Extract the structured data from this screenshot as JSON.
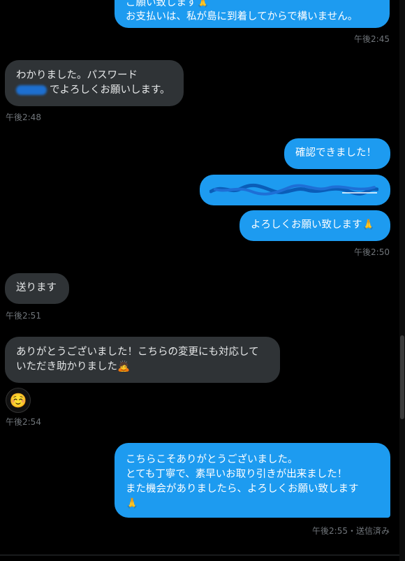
{
  "messages": {
    "m1_line1": "ご願い致します🙏",
    "m1_line2": "お支払いは、私が島に到着してからで構いません。",
    "m1_time": "午後2:45",
    "m2_line1": "わかりました。パスワード",
    "m2_line2": "でよろしくお願いします。",
    "m2_time": "午後2:48",
    "m3_text": "確認できました！",
    "m5_text": "よろしくお願い致します🙏",
    "m5_time": "午後2:50",
    "m6_text": "送ります",
    "m6_time": "午後2:51",
    "m7_line1": "ありがとうございました！こちらの変更にも対応して",
    "m7_line2": "いただき助かりました🙇",
    "m8_emoji": "☺️",
    "m8_time": "午後2:54",
    "m9_line1": "こちらこそありがとうございました。",
    "m9_line2": "とても丁寧で、素早いお取り引きが出来ました！",
    "m9_line3": "また機会がありましたら、よろしくお願い致します",
    "m9_line4": "🙏",
    "m9_time": "午後2:55・送信済み"
  },
  "colors": {
    "outgoing": "#1d9bf0",
    "incoming": "#2f3336",
    "meta": "#71767b",
    "background": "#000000"
  }
}
